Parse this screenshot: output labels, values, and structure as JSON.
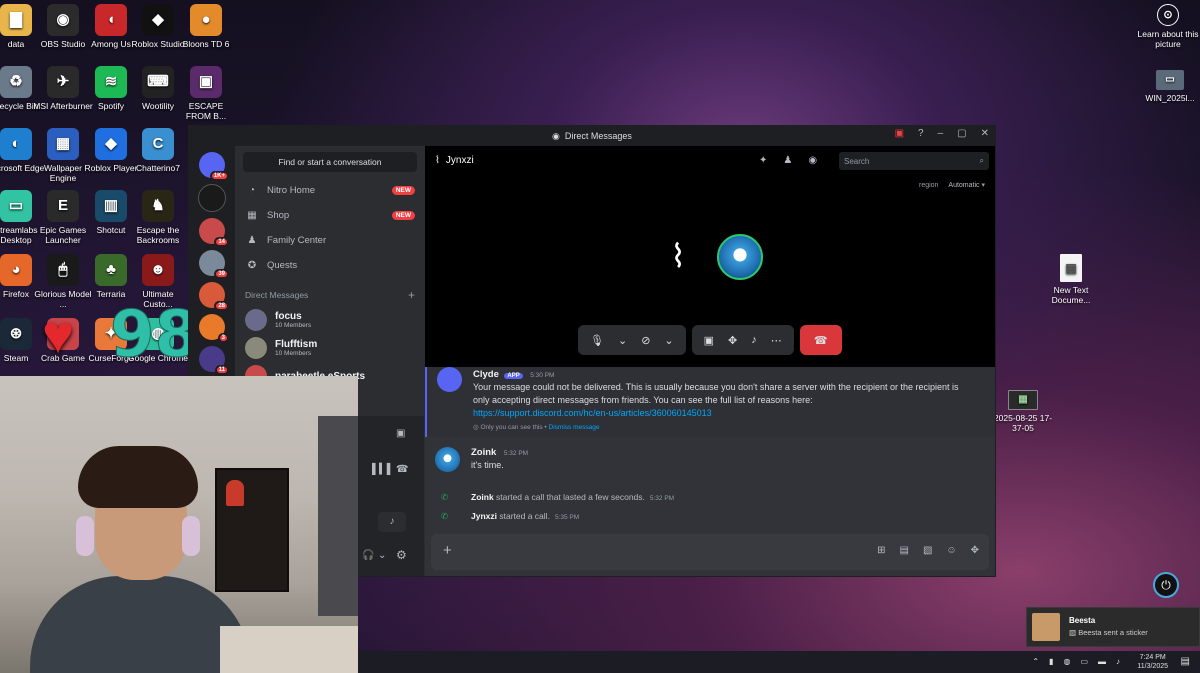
{
  "desktop": {
    "icons": [
      {
        "label": "data",
        "color": "#e8b54a",
        "glyph": "▇"
      },
      {
        "label": "OBS Studio",
        "color": "#2b2b2b",
        "glyph": "◉"
      },
      {
        "label": "Among Us",
        "color": "#c8282a",
        "glyph": "◖"
      },
      {
        "label": "Roblox Studio",
        "color": "#111111",
        "glyph": "◆"
      },
      {
        "label": "Bloons TD 6",
        "color": "#e38a2b",
        "glyph": "●"
      },
      {
        "label": "Recycle Bin",
        "color": "#6a7a8a",
        "glyph": "♻"
      },
      {
        "label": "MSI Afterburner",
        "color": "#2a2a2a",
        "glyph": "✈"
      },
      {
        "label": "Spotify",
        "color": "#1db954",
        "glyph": "≋"
      },
      {
        "label": "Wootility",
        "color": "#222222",
        "glyph": "⌨"
      },
      {
        "label": "ESCAPE FROM B...",
        "color": "#5a2a6a",
        "glyph": "▣"
      },
      {
        "label": "Microsoft Edge",
        "color": "#1f7fcf",
        "glyph": "◐"
      },
      {
        "label": "Wallpaper Engine",
        "color": "#2a5fbf",
        "glyph": "▦"
      },
      {
        "label": "Roblox Player",
        "color": "#1f6fe0",
        "glyph": "◆"
      },
      {
        "label": "Chatterino7",
        "color": "#3a8fd0",
        "glyph": "C"
      },
      {
        "label": "Streamlabs Desktop",
        "color": "#31c3a2",
        "glyph": "▭"
      },
      {
        "label": "Epic Games Launcher",
        "color": "#2a2a2a",
        "glyph": "E"
      },
      {
        "label": "Shotcut",
        "color": "#1a4a6a",
        "glyph": "▥"
      },
      {
        "label": "Escape the Backrooms",
        "color": "#2a2616",
        "glyph": "♞"
      },
      {
        "label": "Firefox",
        "color": "#e5672a",
        "glyph": "◕"
      },
      {
        "label": "Glorious Model ...",
        "color": "#1a1a1a",
        "glyph": "🖱"
      },
      {
        "label": "Terraria",
        "color": "#3a6a2a",
        "glyph": "♣"
      },
      {
        "label": "Ultimate Custo...",
        "color": "#8a1a1a",
        "glyph": "☻"
      },
      {
        "label": "Steam",
        "color": "#1b2838",
        "glyph": "⊛"
      },
      {
        "label": "Crab Game",
        "color": "#c8444a",
        "glyph": "♥"
      },
      {
        "label": "CurseForge",
        "color": "#e8793a",
        "glyph": "✦"
      },
      {
        "label": "Google Chrome",
        "color": "#2fbf9f",
        "glyph": "◍"
      }
    ],
    "right_icons": [
      {
        "label": "Learn about this picture",
        "glyph": "⊙"
      },
      {
        "label": "WIN_2025l...",
        "glyph": "▭"
      },
      {
        "label": "New Text Docume...",
        "glyph": "▤"
      },
      {
        "label": "2025-08-25 17-37-05",
        "glyph": "▦"
      }
    ],
    "overlay_number": "98"
  },
  "window": {
    "title": "Direct Messages",
    "guild_badges": [
      "1K+",
      "14",
      "39",
      "28",
      "3",
      "11"
    ],
    "search_prompt": "Find or start a conversation",
    "nav": [
      {
        "label": "Nitro Home",
        "badge": "NEW",
        "icon": "nitro-icon",
        "glyph": "◔"
      },
      {
        "label": "Shop",
        "badge": "NEW",
        "icon": "shop-icon",
        "glyph": "▦"
      },
      {
        "label": "Family Center",
        "badge": "",
        "icon": "family-icon",
        "glyph": "♟"
      },
      {
        "label": "Quests",
        "badge": "",
        "icon": "quests-icon",
        "glyph": "✪"
      }
    ],
    "dm_header": "Direct Messages",
    "dms": [
      {
        "name": "focus",
        "sub": "10 Members",
        "color": "#6a6a8a"
      },
      {
        "name": "Flufftism",
        "sub": "10 Members",
        "color": "#8a8a7a"
      },
      {
        "name": "parabeetle eSports",
        "sub": "",
        "color": "#c84a4a"
      }
    ],
    "call": {
      "channel_name": "Jynxzi",
      "search_placeholder": "Search",
      "region_label": "region",
      "region_value": "Automatic"
    },
    "messages": [
      {
        "author": "Clyde",
        "tag": "APP",
        "time": "5:30 PM",
        "text": "Your message could not be delivered. This is usually because you don't share a server with the recipient or the recipient is only accepting direct messages from friends. You can see the full list of reasons here:",
        "link": "https://support.discord.com/hc/en-us/articles/360060145013",
        "note": "Only you can see this •",
        "dismiss": "Dismiss message"
      },
      {
        "author": "Zoink",
        "time": "5:32 PM",
        "text": "it's time."
      }
    ],
    "system": [
      {
        "name": "Zoink",
        "text": "started a call that lasted a few seconds.",
        "time": "5:32 PM"
      },
      {
        "name": "Jynxzi",
        "text": "started a call.",
        "time": "5:35 PM"
      }
    ]
  },
  "notification": {
    "title": "Beesta",
    "text": "Beesta sent a sticker"
  },
  "taskbar": {
    "time": "7:24 PM",
    "date": "11/3/2025"
  }
}
